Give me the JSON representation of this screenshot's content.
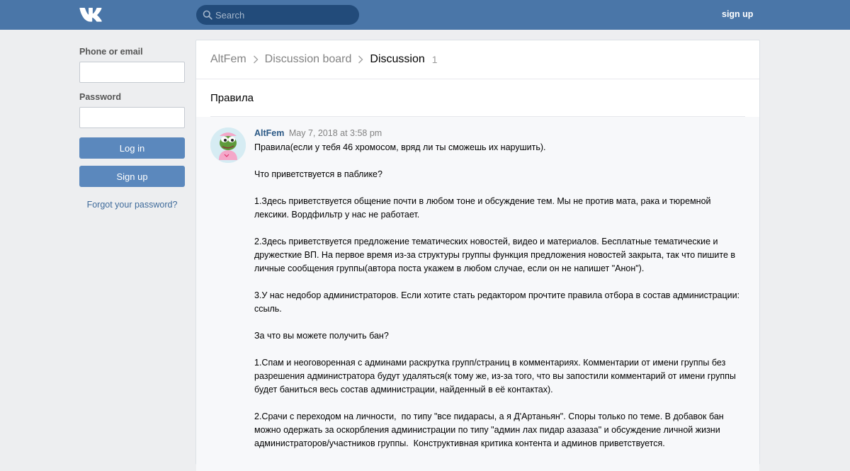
{
  "header": {
    "search_placeholder": "Search",
    "signup_label": "sign up"
  },
  "login": {
    "phone_label": "Phone or email",
    "password_label": "Password",
    "login_button": "Log in",
    "signup_button": "Sign up",
    "forgot_link": "Forgot your password?"
  },
  "breadcrumbs": {
    "group": "AltFem",
    "board": "Discussion board",
    "current": "Discussion",
    "count": "1"
  },
  "topic": {
    "title": "Правила"
  },
  "post": {
    "author": "AltFem",
    "date": "May 7, 2018 at 3:58 pm",
    "paragraphs": [
      "Правила(если у тебя 46 хромосом, вряд ли ты сможешь их нарушить).",
      "Что приветствуется в паблике?",
      "1.Здесь приветствуется общение почти в любом тоне и обсуждение тем. Мы не против мата, рака и тюремной лексики. Вордфильтр у нас не работает.",
      "2.Здесь приветствуется предложение тематических новостей, видео и материалов. Бесплатные тематические и дружесткие ВП. На первое время из-за структуры группы функция предложения новостей закрыта, так что пишите в личные сообщения группы(автора поста укажем в любом случае, если он не напишет \"Анон\").",
      "3.У нас недобор администраторов. Если хотите стать редактором прочтите правила отбора в состав администрации: ссыль.",
      "За что вы можете получить бан?",
      "1.Спам и неоговоренная с админами раскрутка групп/страниц в комментариях. Комментарии от имени группы без разрешения администратора будут удаляться(к тому же, из-за того, что вы запостили комментарий от имени группы будет баниться весь состав администрации, найденный в её контактах).",
      "2.Срачи с переходом на личности,  по типу \"все пидарасы, а я Д'Артаньян\". Споры только по теме. В добавок бан можно одержать за оскорбления администрации по типу \"админ лах пидар азазаза\" и обсуждение личной жизни администраторов/участников группы.  Конструктивная критика контента и админов приветствуется."
    ]
  },
  "colors": {
    "header_bg": "#4a76a8",
    "search_bg": "#224b7a",
    "button_bg": "#5b88bd",
    "link": "#2a5885",
    "page_bg": "#edeef0"
  }
}
